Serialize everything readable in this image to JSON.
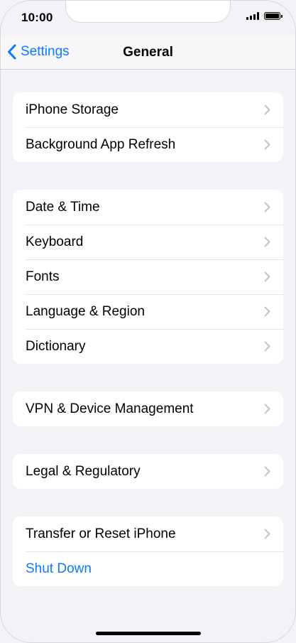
{
  "status_bar": {
    "time": "10:00",
    "battery_level": 1.0
  },
  "nav": {
    "back_label": "Settings",
    "title": "General"
  },
  "groups": [
    {
      "rows": [
        {
          "label": "iPhone Storage"
        },
        {
          "label": "Background App Refresh"
        }
      ]
    },
    {
      "rows": [
        {
          "label": "Date & Time"
        },
        {
          "label": "Keyboard"
        },
        {
          "label": "Fonts"
        },
        {
          "label": "Language & Region"
        },
        {
          "label": "Dictionary"
        }
      ]
    },
    {
      "rows": [
        {
          "label": "VPN & Device Management"
        }
      ]
    },
    {
      "rows": [
        {
          "label": "Legal & Regulatory"
        }
      ]
    },
    {
      "rows": [
        {
          "label": "Transfer or Reset iPhone"
        },
        {
          "label": "Shut Down"
        }
      ]
    }
  ],
  "colors": {
    "accent": "#0a7aff",
    "background": "#f2f2f7",
    "chevron": "#c4c4c7"
  },
  "icons": {
    "back": "chevron-left-icon",
    "row": "chevron-right-icon"
  }
}
